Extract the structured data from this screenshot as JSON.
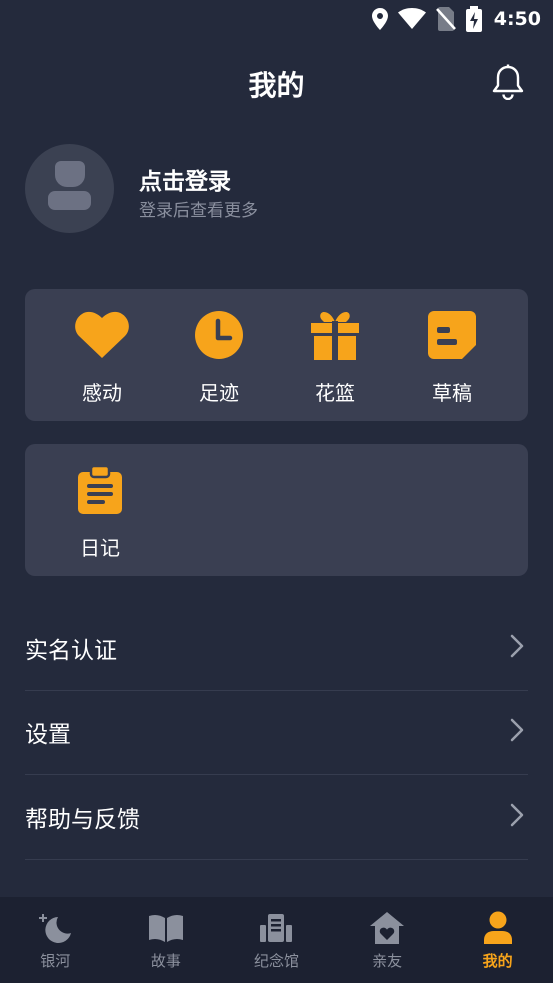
{
  "status_bar": {
    "time": "4:50"
  },
  "header": {
    "title": "我的"
  },
  "profile": {
    "title": "点击登录",
    "subtitle": "登录后查看更多"
  },
  "features": [
    {
      "label": "感动",
      "icon": "heart-icon"
    },
    {
      "label": "足迹",
      "icon": "clock-icon"
    },
    {
      "label": "花篮",
      "icon": "gift-icon"
    },
    {
      "label": "草稿",
      "icon": "draft-icon"
    }
  ],
  "extras": [
    {
      "label": "日记",
      "icon": "clipboard-icon"
    }
  ],
  "menu": [
    {
      "label": "实名认证"
    },
    {
      "label": "设置"
    },
    {
      "label": "帮助与反馈"
    }
  ],
  "tabs": [
    {
      "label": "银河",
      "icon": "moon-stars-icon"
    },
    {
      "label": "故事",
      "icon": "book-icon"
    },
    {
      "label": "纪念馆",
      "icon": "memorial-icon"
    },
    {
      "label": "亲友",
      "icon": "home-heart-icon"
    },
    {
      "label": "我的",
      "icon": "person-icon",
      "active": true
    }
  ],
  "colors": {
    "accent": "#f7a41b",
    "background": "#242a3c",
    "card": "#3a3f52",
    "tabbar": "#1c2131"
  }
}
